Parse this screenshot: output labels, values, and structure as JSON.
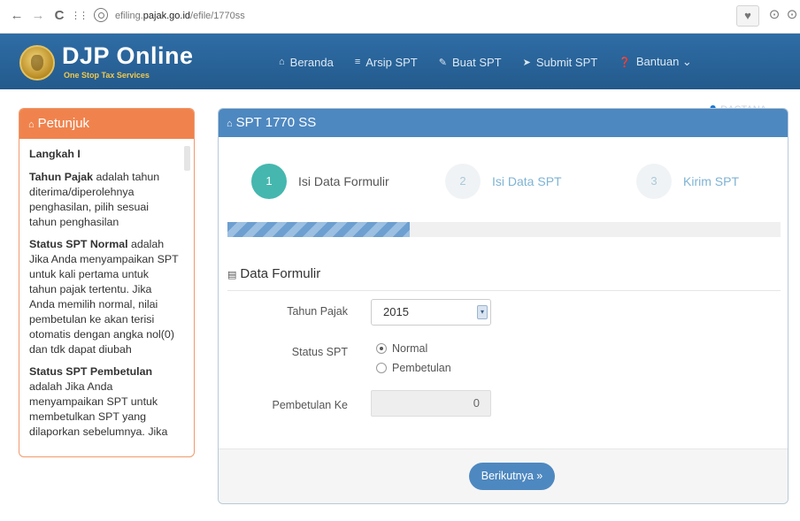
{
  "browser": {
    "back_icon": "←",
    "forward_icon": "→",
    "reload_icon": "C",
    "apps_icon": "⋮⋮",
    "url_prefix": "efiling.",
    "url_domain": "pajak.go.id",
    "url_path": "/efile/1770ss",
    "heart_icon": "♥",
    "ext1_icon": "⊙",
    "ext2_icon": "⊙"
  },
  "header": {
    "logo_title": "DJP Online",
    "logo_subtitle": "One Stop Tax Services",
    "menu": [
      {
        "icon": "⌂",
        "label": "Beranda"
      },
      {
        "icon": "≡",
        "label": "Arsip SPT"
      },
      {
        "icon": "✎",
        "label": "Buat SPT"
      },
      {
        "icon": "➤",
        "label": "Submit SPT"
      },
      {
        "icon": "❓",
        "label": "Bantuan ⌄"
      }
    ]
  },
  "user": {
    "icon": "👤",
    "name": "DACTANA ⌄"
  },
  "petunjuk": {
    "icon": "⌂",
    "title": "Petunjuk",
    "heading": "Langkah I",
    "p1_bold": "Tahun Pajak",
    "p1_text": " adalah tahun diterima/diperolehnya penghasilan, pilih sesuai tahun penghasilan",
    "p2_bold": "Status SPT Normal",
    "p2_text": " adalah Jika Anda menyampaikan SPT untuk kali pertama untuk tahun pajak tertentu. Jika Anda memilih normal, nilai pembetulan ke akan terisi otomatis dengan angka nol(0) dan tdk dapat diubah",
    "p3_bold": "Status SPT Pembetulan",
    "p3_text": " adalah Jika Anda menyampaikan SPT untuk membetulkan SPT yang dilaporkan sebelumnya. Jika"
  },
  "main": {
    "icon": "⌂",
    "title": "SPT 1770 SS",
    "steps": [
      {
        "number": "1",
        "label": "Isi Data Formulir"
      },
      {
        "number": "2",
        "label": "Isi Data SPT"
      },
      {
        "number": "3",
        "label": "Kirim SPT"
      }
    ],
    "progress": 0.33,
    "section_icon": "▤",
    "section_title": "Data Formulir",
    "tahun_label": "Tahun Pajak",
    "tahun_value": "2015",
    "tahun_arrow": "▾",
    "status_label": "Status SPT",
    "status_options": [
      "Normal",
      "Pembetulan"
    ],
    "pembetulan_label": "Pembetulan Ke",
    "pembetulan_value": "0",
    "next_button": "Berikutnya »"
  }
}
